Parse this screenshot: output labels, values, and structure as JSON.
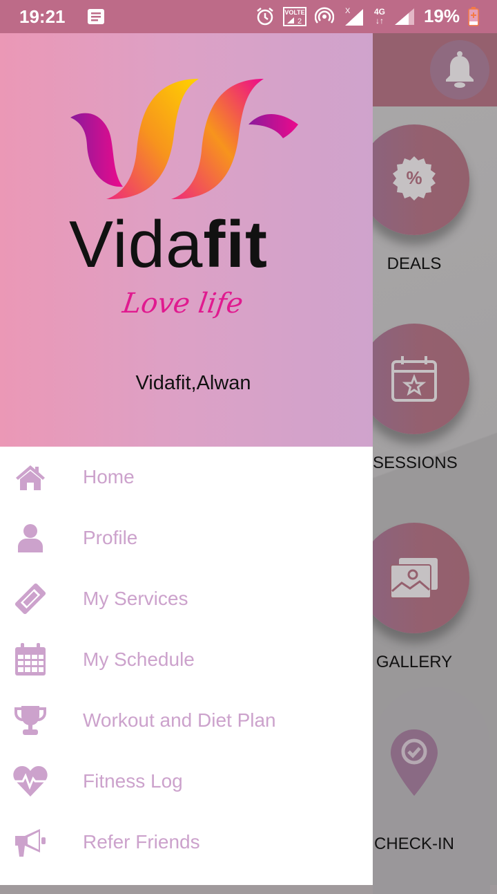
{
  "status_bar": {
    "time": "19:21",
    "battery_percent": "19%",
    "network_label": "4G",
    "volte_label": "VOLTE",
    "sim_number": "2",
    "icons": [
      "notes-icon",
      "alarm-icon",
      "volte-icon",
      "hotspot-icon",
      "signal-no-service-icon",
      "data-arrows-icon",
      "signal-icon",
      "battery-low-icon"
    ]
  },
  "drawer": {
    "brand": {
      "name_light": "Vida",
      "name_bold": "fit",
      "tagline": "Love life"
    },
    "user_name": "Vidafit,Alwan",
    "items": [
      {
        "label": "Home",
        "icon": "home-icon"
      },
      {
        "label": "Profile",
        "icon": "user-icon"
      },
      {
        "label": "My Services",
        "icon": "ticket-icon"
      },
      {
        "label": "My Schedule",
        "icon": "calendar-icon"
      },
      {
        "label": "Workout and Diet Plan",
        "icon": "trophy-icon"
      },
      {
        "label": "Fitness Log",
        "icon": "heartbeat-icon"
      },
      {
        "label": "Refer Friends",
        "icon": "megaphone-icon"
      }
    ]
  },
  "background_app": {
    "tiles": [
      {
        "label": "DEALS",
        "icon": "discount-badge-icon"
      },
      {
        "label": "SESSIONS",
        "icon": "calendar-star-icon"
      },
      {
        "label": "GALLERY",
        "icon": "gallery-icon"
      },
      {
        "label": "CHECK-IN",
        "icon": "location-check-icon"
      }
    ]
  },
  "colors": {
    "status_bar": "#bd6b88",
    "menu_text": "#cca2cc",
    "tagline": "#e01a8f",
    "header_gradient_start": "#eb98b6",
    "header_gradient_end": "#cfa3cc"
  }
}
